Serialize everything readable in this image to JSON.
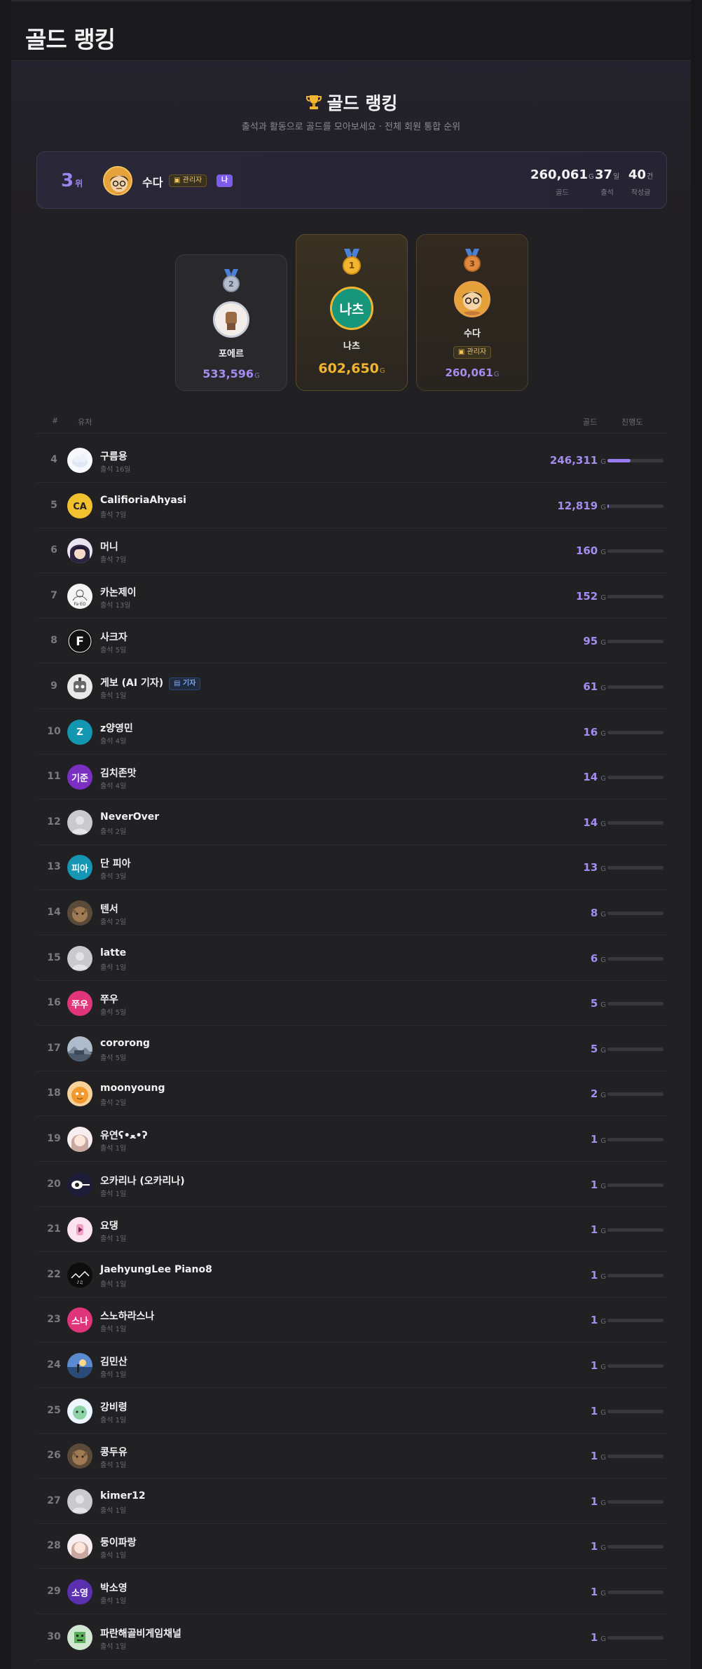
{
  "page": {
    "title": "골드 랭킹"
  },
  "hero": {
    "title": "골드 랭킹",
    "subtitle": "출석과 활동으로 골드를 모아보세요 · 전체 회원 통합 순위"
  },
  "my": {
    "rank": "3",
    "rank_unit": "위",
    "name": "수다",
    "role": "관리자",
    "me_badge": "나",
    "gold": "260,061",
    "gold_unit": "G",
    "gold_label": "골드",
    "attend": "37",
    "attend_unit": "일",
    "attend_label": "출석",
    "posts": "40",
    "posts_unit": "건",
    "posts_label": "작성글"
  },
  "podium": {
    "first": {
      "medal": "1",
      "name": "나츠",
      "avatar_text": "나츠",
      "gold": "602,650",
      "unit": "G"
    },
    "second": {
      "medal": "2",
      "name": "포에르",
      "gold": "533,596",
      "unit": "G"
    },
    "third": {
      "medal": "3",
      "name": "수다",
      "role": "관리자",
      "gold": "260,061",
      "unit": "G"
    }
  },
  "colors": {
    "accent": "#9d86f0",
    "gold": "#f2b531",
    "silver": "#9aa4b8",
    "bronze": "#d9823c"
  },
  "table": {
    "col_rank": "#",
    "col_user": "유저",
    "col_gold": "골드",
    "col_progress": "진행도",
    "rows": [
      {
        "rank": "4",
        "name": "구름용",
        "sub": "출석 16일",
        "gold": "246,311",
        "unit": "G",
        "progress": 0.41,
        "avatar": "cloud"
      },
      {
        "rank": "5",
        "name": "CalifioriaAhyasi",
        "sub": "출석 7일",
        "gold": "12,819",
        "unit": "G",
        "progress": 0.02,
        "avatar": "ca"
      },
      {
        "rank": "6",
        "name": "머니",
        "sub": "출석 7일",
        "gold": "160",
        "unit": "G",
        "progress": 0,
        "avatar": "anime"
      },
      {
        "rank": "7",
        "name": "카논제이",
        "sub": "출석 13일",
        "gold": "152",
        "unit": "G",
        "progress": 0,
        "avatar": "sketch"
      },
      {
        "rank": "8",
        "name": "사크자",
        "sub": "출석 5일",
        "gold": "95",
        "unit": "G",
        "progress": 0,
        "avatar": "f"
      },
      {
        "rank": "9",
        "name": "게보 (AI 기자)",
        "sub": "출석 1일",
        "badge": "기자",
        "gold": "61",
        "unit": "G",
        "progress": 0,
        "avatar": "robot"
      },
      {
        "rank": "10",
        "name": "z양영민",
        "sub": "출석 4일",
        "gold": "16",
        "unit": "G",
        "progress": 0,
        "avatar": "text",
        "avatar_text": "Z",
        "avatar_color": "#1396b0"
      },
      {
        "rank": "11",
        "name": "김치존맛",
        "sub": "출석 4일",
        "gold": "14",
        "unit": "G",
        "progress": 0,
        "avatar": "text",
        "avatar_text": "기준",
        "avatar_color": "#7a2fc2"
      },
      {
        "rank": "12",
        "name": "NeverOver",
        "sub": "출석 2일",
        "gold": "14",
        "unit": "G",
        "progress": 0,
        "avatar": "blank"
      },
      {
        "rank": "13",
        "name": "단 피아",
        "sub": "출석 3일",
        "gold": "13",
        "unit": "G",
        "progress": 0,
        "avatar": "text",
        "avatar_text": "피아",
        "avatar_color": "#1496b4"
      },
      {
        "rank": "14",
        "name": "텐서",
        "sub": "출석 2일",
        "gold": "8",
        "unit": "G",
        "progress": 0,
        "avatar": "cat"
      },
      {
        "rank": "15",
        "name": "latte",
        "sub": "출석 1일",
        "gold": "6",
        "unit": "G",
        "progress": 0,
        "avatar": "blank"
      },
      {
        "rank": "16",
        "name": "쭈우",
        "sub": "출석 5일",
        "gold": "5",
        "unit": "G",
        "progress": 0,
        "avatar": "text",
        "avatar_text": "쭈우",
        "avatar_color": "#e0357b"
      },
      {
        "rank": "17",
        "name": "cororong",
        "sub": "출석 5일",
        "gold": "5",
        "unit": "G",
        "progress": 0,
        "avatar": "landscape"
      },
      {
        "rank": "18",
        "name": "moonyoung",
        "sub": "출석 2일",
        "gold": "2",
        "unit": "G",
        "progress": 0,
        "avatar": "orange"
      },
      {
        "rank": "19",
        "name": "유연ʕ•ﻌ•ʔ",
        "sub": "출석 1일",
        "gold": "1",
        "unit": "G",
        "progress": 0,
        "avatar": "girl"
      },
      {
        "rank": "20",
        "name": "오카리나 (오카리나)",
        "sub": "출석 1일",
        "gold": "1",
        "unit": "G",
        "progress": 0,
        "avatar": "dark"
      },
      {
        "rank": "21",
        "name": "요댕",
        "sub": "출석 1일",
        "gold": "1",
        "unit": "G",
        "progress": 0,
        "avatar": "pink"
      },
      {
        "rank": "22",
        "name": "JaehyungLee Piano8",
        "sub": "출석 1일",
        "gold": "1",
        "unit": "G",
        "progress": 0,
        "avatar": "black"
      },
      {
        "rank": "23",
        "name": "스노하라스나",
        "sub": "출석 1일",
        "gold": "1",
        "unit": "G",
        "progress": 0,
        "avatar": "text",
        "avatar_text": "스나",
        "avatar_color": "#e0357b"
      },
      {
        "rank": "24",
        "name": "김민산",
        "sub": "출석 1일",
        "gold": "1",
        "unit": "G",
        "progress": 0,
        "avatar": "sky"
      },
      {
        "rank": "25",
        "name": "강비령",
        "sub": "출석 1일",
        "gold": "1",
        "unit": "G",
        "progress": 0,
        "avatar": "character"
      },
      {
        "rank": "26",
        "name": "콩두유",
        "sub": "출석 1일",
        "gold": "1",
        "unit": "G",
        "progress": 0,
        "avatar": "cat"
      },
      {
        "rank": "27",
        "name": "kimer12",
        "sub": "출석 1일",
        "gold": "1",
        "unit": "G",
        "progress": 0,
        "avatar": "blank"
      },
      {
        "rank": "28",
        "name": "둥이파랑",
        "sub": "출석 1일",
        "gold": "1",
        "unit": "G",
        "progress": 0,
        "avatar": "girl"
      },
      {
        "rank": "29",
        "name": "박소영",
        "sub": "출석 1일",
        "gold": "1",
        "unit": "G",
        "progress": 0,
        "avatar": "text",
        "avatar_text": "소영",
        "avatar_color": "#5a2fb0"
      },
      {
        "rank": "30",
        "name": "파란해골비게임채널",
        "sub": "출석 1일",
        "gold": "1",
        "unit": "G",
        "progress": 0,
        "avatar": "pixel"
      }
    ]
  }
}
